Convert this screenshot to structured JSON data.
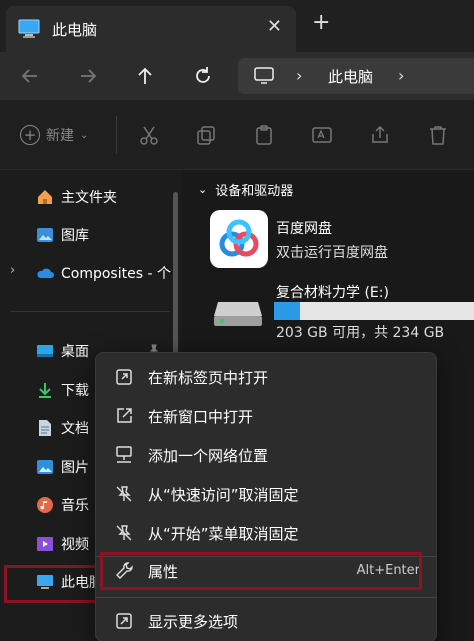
{
  "tab": {
    "title": "此电脑",
    "close": "✕",
    "new": "+"
  },
  "address": {
    "sep": "›",
    "location": "此电脑"
  },
  "toolbar": {
    "new_label": "新建"
  },
  "sidebar": {
    "items": [
      {
        "label": "主文件夹",
        "icon": "home-icon"
      },
      {
        "label": "图库",
        "icon": "gallery-icon"
      },
      {
        "label": "Composites - 个",
        "icon": "cloud-icon"
      },
      {
        "label": "桌面",
        "icon": "desktop-icon"
      },
      {
        "label": "下载",
        "icon": "download-icon"
      },
      {
        "label": "文档",
        "icon": "document-icon"
      },
      {
        "label": "图片",
        "icon": "pictures-icon"
      },
      {
        "label": "音乐",
        "icon": "music-icon"
      },
      {
        "label": "视频",
        "icon": "video-icon"
      },
      {
        "label": "此电脑",
        "icon": "this-pc-icon"
      }
    ]
  },
  "main": {
    "section_title": "设备和驱动器",
    "app": {
      "name": "百度网盘",
      "subtitle": "双击运行百度网盘"
    },
    "disk": {
      "name": "复合材料力学 (E:)",
      "free": "203 GB 可用，共 234 GB",
      "used_fraction": 0.13
    }
  },
  "context_menu": {
    "items": [
      {
        "label": "在新标签页中打开",
        "icon": "open-new-tab-icon"
      },
      {
        "label": "在新窗口中打开",
        "icon": "open-new-window-icon"
      },
      {
        "label": "添加一个网络位置",
        "icon": "network-location-icon"
      },
      {
        "label": "从“快速访问”取消固定",
        "icon": "unpin-icon"
      },
      {
        "label": "从“开始”菜单取消固定",
        "icon": "unpin-start-icon"
      },
      {
        "label": "属性",
        "icon": "wrench-icon",
        "shortcut": "Alt+Enter"
      },
      {
        "label": "显示更多选项",
        "icon": "more-options-icon"
      }
    ]
  },
  "colors": {
    "accent": "#2b9be8",
    "highlight_border": "#8b1424",
    "menu_bg": "#2c2c2c"
  }
}
